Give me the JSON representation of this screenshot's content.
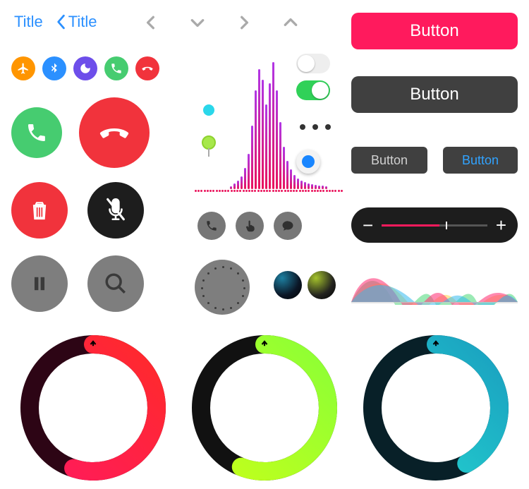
{
  "nav": {
    "title": "Title",
    "back_title": "Title"
  },
  "status_icons": [
    {
      "name": "airplane-mode-icon",
      "color": "#ff9500"
    },
    {
      "name": "bluetooth-icon",
      "color": "#2b90ff"
    },
    {
      "name": "do-not-disturb-icon",
      "color": "#6d4eea"
    },
    {
      "name": "phone-icon",
      "color": "#46cc70"
    },
    {
      "name": "hangup-icon",
      "color": "#f1333c"
    }
  ],
  "call": {
    "accept": "accept-call",
    "decline": "decline-call"
  },
  "actions": {
    "delete": "delete-button",
    "mute": "mute-button",
    "pause": "pause-button",
    "search": "search-button",
    "dial": "dial-button"
  },
  "small_action_pills": [
    {
      "name": "phone-icon"
    },
    {
      "name": "touch-icon"
    },
    {
      "name": "chat-icon"
    }
  ],
  "toggles": {
    "off": false,
    "on": true
  },
  "buttons": {
    "primary": "Button",
    "secondary": "Button",
    "small_grey": "Button",
    "small_blue": "Button"
  },
  "slider": {
    "value": 55,
    "min": 0,
    "max": 100
  },
  "colors": {
    "accent_pink": "#ff1a5d",
    "accent_blue": "#2b90ff",
    "green": "#46cc70",
    "red": "#f1333c",
    "dark": "#404040"
  },
  "chart_data": [
    {
      "type": "bar",
      "title": "audio-spectrum",
      "x": [
        0,
        1,
        2,
        3,
        4,
        5,
        6,
        7,
        8,
        9,
        10,
        11,
        12,
        13,
        14,
        15,
        16,
        17,
        18,
        19,
        20,
        21,
        22,
        23,
        24,
        25,
        26,
        27
      ],
      "values": [
        4,
        8,
        12,
        18,
        30,
        50,
        90,
        140,
        170,
        155,
        120,
        150,
        180,
        140,
        95,
        60,
        40,
        28,
        20,
        15,
        12,
        10,
        8,
        7,
        6,
        5,
        5,
        4
      ],
      "ylim": [
        0,
        190
      ]
    },
    {
      "type": "area",
      "title": "siri-wave",
      "series": [
        {
          "name": "pink",
          "color": "#ff3b7b"
        },
        {
          "name": "yellow",
          "color": "#ffd24a"
        },
        {
          "name": "green",
          "color": "#48d979"
        },
        {
          "name": "blue",
          "color": "#33b9ee"
        }
      ]
    }
  ],
  "rings": [
    {
      "name": "activity-ring-red",
      "percent": 55,
      "track": "#2d0515",
      "stroke_start": "#ff1a5d",
      "stroke_end": "#ff2a2a"
    },
    {
      "name": "activity-ring-green",
      "percent": 56,
      "track": "#111",
      "stroke_start": "#c4ff1a",
      "stroke_end": "#8bff36"
    },
    {
      "name": "activity-ring-cyan",
      "percent": 42,
      "track": "#082028",
      "stroke_start": "#24d5d0",
      "stroke_end": "#1aa0c0"
    }
  ]
}
